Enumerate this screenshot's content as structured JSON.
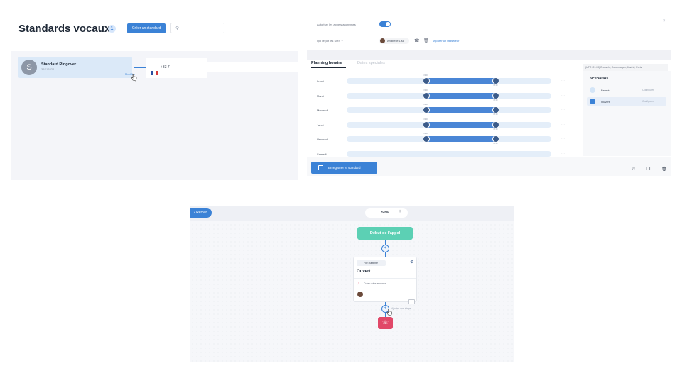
{
  "panel1": {
    "title": "Standards vocaux",
    "count": "1",
    "create_button": "Créer un standard",
    "card": {
      "avatar_letter": "S",
      "name": "Standard Ringover",
      "number": "33S13424",
      "link": "Modifier"
    },
    "phone": "+33 7"
  },
  "panel2": {
    "anon_label": "Autoriser les appels anonymes",
    "sms_label": "Qui reçoit les SMS ?",
    "user_name": "Anabelle Lisa",
    "add_user": "Ajouter un utilisateur",
    "tabs": {
      "active": "Planning horaire",
      "inactive": "Dates spéciales"
    },
    "timezone": "(UTC+01:00) Brussels, Copenhagen, Madrid, Paris",
    "days": [
      {
        "label": "Lundi",
        "open": "09:00",
        "close": "18:00",
        "start_pct": 0.39,
        "end_pct": 0.73
      },
      {
        "label": "Mardi",
        "open": "09:00",
        "close": "18:00",
        "start_pct": 0.39,
        "end_pct": 0.73
      },
      {
        "label": "Mercredi",
        "open": "09:00",
        "close": "18:00",
        "start_pct": 0.39,
        "end_pct": 0.73
      },
      {
        "label": "Jeudi",
        "open": "09:00",
        "close": "18:00",
        "start_pct": 0.39,
        "end_pct": 0.73
      },
      {
        "label": "Vendredi",
        "open": "09:00",
        "close": "18:00",
        "start_pct": 0.39,
        "end_pct": 0.73
      },
      {
        "label": "Samedi",
        "open": "",
        "close": "",
        "start_pct": 0,
        "end_pct": 0
      }
    ],
    "scenarios_title": "Scénarios",
    "scenarios": [
      {
        "name": "Fermé",
        "action": "Configurer",
        "color": "#d4e5f7"
      },
      {
        "name": "Ouvert",
        "action": "Configurer",
        "color": "#3b82d6"
      }
    ],
    "save_button": "Enregistrer le standard"
  },
  "panel3": {
    "back": "Retour",
    "zoom": "50%",
    "start_node": "Début de l'appel",
    "node": {
      "badge": "File d'attente",
      "title": "Ouvert",
      "announcement": "Créer votre annonce"
    },
    "add_step": "Ajouter une étape"
  }
}
